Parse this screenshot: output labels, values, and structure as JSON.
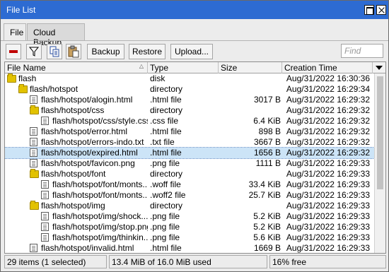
{
  "window": {
    "title": "File List"
  },
  "tabs": [
    {
      "label": "File"
    },
    {
      "label": "Cloud Backup"
    }
  ],
  "toolbar": {
    "remove_icon": "remove-icon",
    "filter_icon": "filter-icon",
    "copy_icon": "copy-icon",
    "paste_icon": "paste-icon",
    "backup_label": "Backup",
    "restore_label": "Restore",
    "upload_label": "Upload...",
    "find_placeholder": "Find"
  },
  "columns": {
    "name": "File Name",
    "type": "Type",
    "size": "Size",
    "date": "Creation Time"
  },
  "rows": [
    {
      "depth": 0,
      "kind": "folder",
      "name": "flash",
      "type": "disk",
      "size": "",
      "date": "Aug/31/2022 16:30:36",
      "selected": false
    },
    {
      "depth": 1,
      "kind": "folder",
      "name": "flash/hotspot",
      "type": "directory",
      "size": "",
      "date": "Aug/31/2022 16:29:34",
      "selected": false
    },
    {
      "depth": 2,
      "kind": "file",
      "name": "flash/hotspot/alogin.html",
      "type": ".html file",
      "size": "3017 B",
      "date": "Aug/31/2022 16:29:32",
      "selected": false
    },
    {
      "depth": 2,
      "kind": "folder",
      "name": "flash/hotspot/css",
      "type": "directory",
      "size": "",
      "date": "Aug/31/2022 16:29:32",
      "selected": false
    },
    {
      "depth": 3,
      "kind": "file",
      "name": "flash/hotspot/css/style.css",
      "type": ".css file",
      "size": "6.4 KiB",
      "date": "Aug/31/2022 16:29:32",
      "selected": false
    },
    {
      "depth": 2,
      "kind": "file",
      "name": "flash/hotspot/error.html",
      "type": ".html file",
      "size": "898 B",
      "date": "Aug/31/2022 16:29:32",
      "selected": false
    },
    {
      "depth": 2,
      "kind": "file",
      "name": "flash/hotspot/errors-indo.txt",
      "type": ".txt file",
      "size": "3667 B",
      "date": "Aug/31/2022 16:29:32",
      "selected": false
    },
    {
      "depth": 2,
      "kind": "file",
      "name": "flash/hotspot/expired.html",
      "type": ".html file",
      "size": "1656 B",
      "date": "Aug/31/2022 16:29:32",
      "selected": true
    },
    {
      "depth": 2,
      "kind": "file",
      "name": "flash/hotspot/favicon.png",
      "type": ".png file",
      "size": "1111 B",
      "date": "Aug/31/2022 16:29:33",
      "selected": false
    },
    {
      "depth": 2,
      "kind": "folder",
      "name": "flash/hotspot/font",
      "type": "directory",
      "size": "",
      "date": "Aug/31/2022 16:29:33",
      "selected": false
    },
    {
      "depth": 3,
      "kind": "file",
      "name": "flash/hotspot/font/monts...",
      "type": ".woff file",
      "size": "33.4 KiB",
      "date": "Aug/31/2022 16:29:33",
      "selected": false
    },
    {
      "depth": 3,
      "kind": "file",
      "name": "flash/hotspot/font/monts...",
      "type": ".woff2 file",
      "size": "25.7 KiB",
      "date": "Aug/31/2022 16:29:33",
      "selected": false
    },
    {
      "depth": 2,
      "kind": "folder",
      "name": "flash/hotspot/img",
      "type": "directory",
      "size": "",
      "date": "Aug/31/2022 16:29:33",
      "selected": false
    },
    {
      "depth": 3,
      "kind": "file",
      "name": "flash/hotspot/img/shock...",
      "type": ".png file",
      "size": "5.2 KiB",
      "date": "Aug/31/2022 16:29:33",
      "selected": false
    },
    {
      "depth": 3,
      "kind": "file",
      "name": "flash/hotspot/img/stop.png",
      "type": ".png file",
      "size": "5.2 KiB",
      "date": "Aug/31/2022 16:29:33",
      "selected": false
    },
    {
      "depth": 3,
      "kind": "file",
      "name": "flash/hotspot/img/thinkin...",
      "type": ".png file",
      "size": "5.6 KiB",
      "date": "Aug/31/2022 16:29:33",
      "selected": false
    },
    {
      "depth": 2,
      "kind": "file",
      "name": "flash/hotspot/invalid.html",
      "type": ".html file",
      "size": "1669 B",
      "date": "Aug/31/2022 16:29:33",
      "selected": false
    }
  ],
  "status": {
    "items": "29 items (1 selected)",
    "usage": "13.4 MiB of 16.0 MiB used",
    "free": "16% free"
  }
}
